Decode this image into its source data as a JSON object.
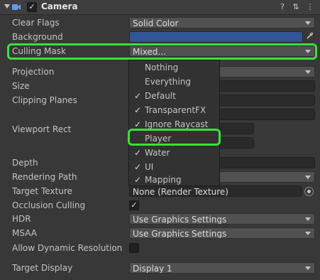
{
  "component": {
    "title": "Camera",
    "enabled_check": "✓"
  },
  "header_icons": {
    "help": "?",
    "presets": "⇅",
    "menu": "⋮"
  },
  "rows": {
    "clear_flags": {
      "label": "Clear Flags",
      "value": "Solid Color"
    },
    "background": {
      "label": "Background",
      "color": "#315595"
    },
    "culling_mask": {
      "label": "Culling Mask",
      "value": "Mixed..."
    },
    "projection": {
      "label": "Projection"
    },
    "size": {
      "label": "Size"
    },
    "clipping_planes": {
      "label": "Clipping Planes"
    },
    "viewport_rect": {
      "label": "Viewport Rect"
    },
    "depth": {
      "label": "Depth"
    },
    "rendering_path": {
      "label": "Rendering Path"
    },
    "target_texture": {
      "label": "Target Texture",
      "value": "None (Render Texture)"
    },
    "occlusion_culling": {
      "label": "Occlusion Culling",
      "check": "✓"
    },
    "hdr": {
      "label": "HDR",
      "value": "Use Graphics Settings"
    },
    "msaa": {
      "label": "MSAA",
      "value": "Use Graphics Settings"
    },
    "allow_dynamic_resolution": {
      "label": "Allow Dynamic Resolution"
    },
    "target_display": {
      "label": "Target Display",
      "value": "Display 1"
    }
  },
  "culling_dropdown": {
    "items": [
      {
        "label": "Nothing",
        "check": ""
      },
      {
        "label": "Everything",
        "check": ""
      },
      {
        "label": "Default",
        "check": "✓"
      },
      {
        "label": "TransparentFX",
        "check": "✓"
      },
      {
        "label": "Ignore Raycast",
        "check": "✓"
      },
      {
        "label": "Player",
        "check": ""
      },
      {
        "label": "Water",
        "check": "✓"
      },
      {
        "label": "UI",
        "check": "✓"
      },
      {
        "label": "Mapping",
        "check": "✓"
      }
    ]
  },
  "colors": {
    "highlight": "#3be03b",
    "panel_bg": "#383838"
  }
}
